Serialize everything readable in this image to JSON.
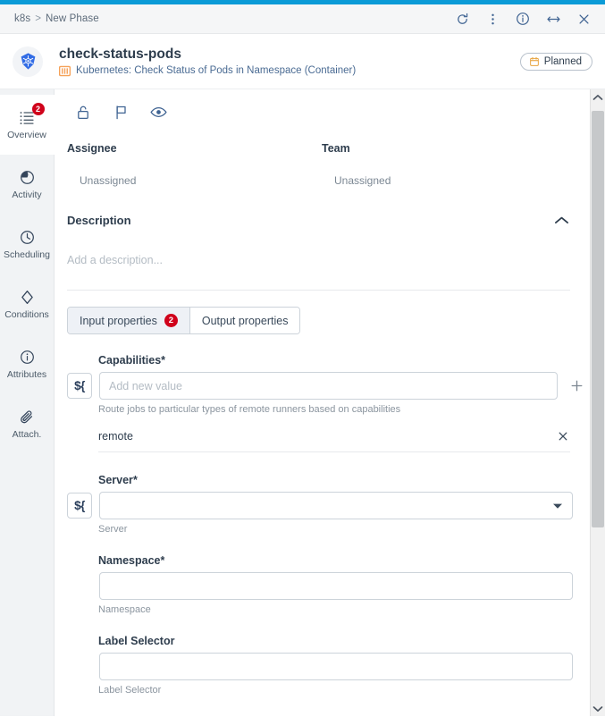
{
  "window": {
    "breadcrumb_root": "k8s",
    "breadcrumb_sep": ">",
    "breadcrumb_current": "New Phase",
    "icons": [
      {
        "name": "refresh-icon",
        "title": "Refresh"
      },
      {
        "name": "more-vertical-icon",
        "title": "More options"
      },
      {
        "name": "info-icon",
        "title": "Information"
      },
      {
        "name": "resize-horizontal-icon",
        "title": "Resize"
      },
      {
        "name": "close-icon",
        "title": "Close"
      }
    ],
    "accent_color": "#0b9bd7"
  },
  "header": {
    "logo_name": "kubernetes-logo",
    "title": "check-status-pods",
    "subtitle": "Kubernetes: Check Status of Pods in Namespace (Container)",
    "subtitle_icon": "container-icon",
    "status": {
      "label": "Planned",
      "icon": "calendar-icon"
    }
  },
  "sidebar": {
    "items": [
      {
        "label": "Overview",
        "icon": "list-icon",
        "badge": "2",
        "active": true
      },
      {
        "label": "Activity",
        "icon": "activity-icon",
        "badge": null,
        "active": false
      },
      {
        "label": "Scheduling",
        "icon": "clock-icon",
        "badge": null,
        "active": false
      },
      {
        "label": "Conditions",
        "icon": "diamond-icon",
        "badge": null,
        "active": false
      },
      {
        "label": "Attributes",
        "icon": "info-icon",
        "badge": null,
        "active": false
      },
      {
        "label": "Attach.",
        "icon": "paperclip-icon",
        "badge": null,
        "active": false
      }
    ]
  },
  "actions": [
    {
      "name": "unlock-icon",
      "title": "Unlock"
    },
    {
      "name": "flag-icon",
      "title": "Flag"
    },
    {
      "name": "eye-icon",
      "title": "Watch"
    }
  ],
  "people": {
    "assignee": {
      "label": "Assignee",
      "value": "Unassigned"
    },
    "team": {
      "label": "Team",
      "value": "Unassigned"
    }
  },
  "description": {
    "title": "Description",
    "placeholder": "Add a description...",
    "collapse_icon": "chevron-up-icon"
  },
  "tabs": [
    {
      "label": "Input properties",
      "badge": "2",
      "active": true
    },
    {
      "label": "Output properties",
      "badge": null,
      "active": false
    }
  ],
  "fields": [
    {
      "label": "Capabilities",
      "required": "*",
      "placeholder": "Add new value",
      "value": "",
      "hint": "Route jobs to particular types of remote runners based on capabilities",
      "expr_button": "${",
      "add_button": "add-icon",
      "chips": [
        {
          "text": "remote",
          "remove_icon": "close-icon"
        }
      ]
    },
    {
      "label": "Server",
      "required": "*",
      "placeholder": "",
      "value": "",
      "hint": "Server",
      "expr_button": "${",
      "select": true,
      "caret_icon": "chevron-down-icon",
      "chips": []
    },
    {
      "label": "Namespace",
      "required": "*",
      "placeholder": "",
      "value": "",
      "hint": "Namespace",
      "expr_button": null,
      "chips": []
    },
    {
      "label": "Label Selector",
      "required": "",
      "placeholder": "",
      "value": "",
      "hint": "Label Selector",
      "expr_button": null,
      "chips": []
    }
  ],
  "scrollbar": {
    "up_icon": "chevron-up-icon",
    "down_icon": "chevron-down-icon"
  }
}
